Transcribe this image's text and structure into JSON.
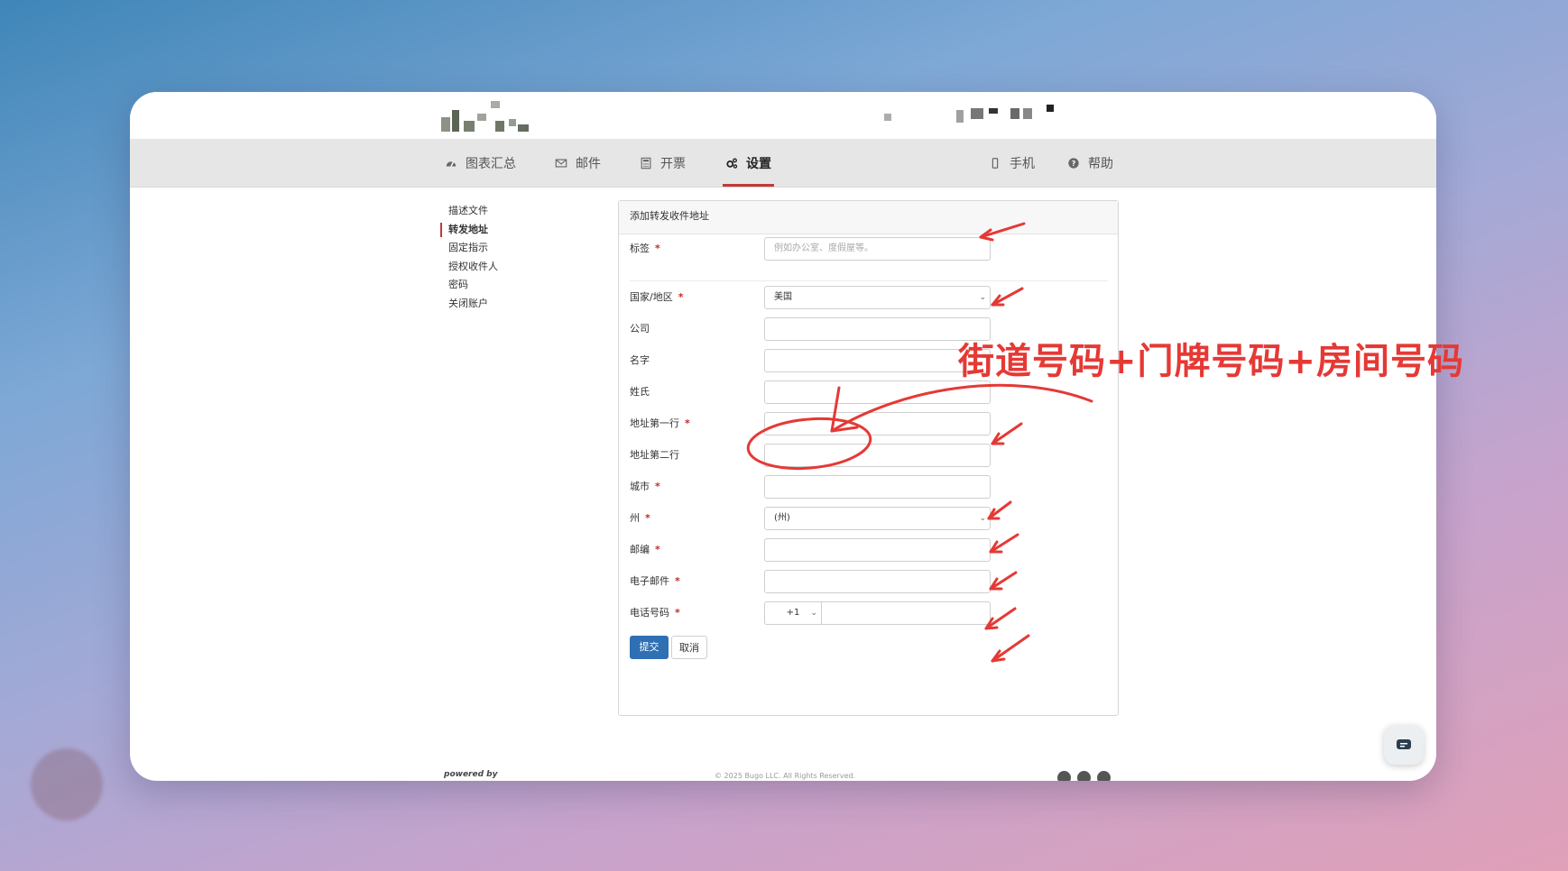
{
  "nav": {
    "left": [
      {
        "label": "图表汇总",
        "icon": "dashboard-icon"
      },
      {
        "label": "邮件",
        "icon": "envelope-icon"
      },
      {
        "label": "开票",
        "icon": "calculator-icon"
      },
      {
        "label": "设置",
        "icon": "gears-icon",
        "active": true
      }
    ],
    "right": [
      {
        "label": "手机",
        "icon": "mobile-icon"
      },
      {
        "label": "帮助",
        "icon": "question-circle-icon"
      }
    ]
  },
  "sidebar": {
    "items": [
      "描述文件",
      "转发地址",
      "固定指示",
      "授权收件人",
      "密码",
      "关闭账户"
    ],
    "active_index": 1
  },
  "form": {
    "title": "添加转发收件地址",
    "fields": [
      {
        "label": "标签",
        "required": true,
        "placeholder": "例如办公室、度假屋等。",
        "type": "text"
      },
      {
        "label": "国家/地区",
        "required": true,
        "value": "美国",
        "type": "select"
      },
      {
        "label": "公司",
        "required": false,
        "type": "text"
      },
      {
        "label": "名字",
        "required": false,
        "type": "text"
      },
      {
        "label": "姓氏",
        "required": false,
        "type": "text"
      },
      {
        "label": "地址第一行",
        "required": true,
        "type": "text"
      },
      {
        "label": "地址第二行",
        "required": false,
        "type": "text"
      },
      {
        "label": "城市",
        "required": true,
        "type": "text"
      },
      {
        "label": "州",
        "required": true,
        "value": "(州)",
        "type": "select"
      },
      {
        "label": "邮编",
        "required": true,
        "type": "text"
      },
      {
        "label": "电子邮件",
        "required": true,
        "type": "text"
      },
      {
        "label": "电话号码",
        "required": true,
        "type": "phone",
        "country_code": "+1"
      }
    ],
    "required_mark": "*",
    "submit_label": "提交",
    "cancel_label": "取消"
  },
  "annotation": {
    "text": "街道号码+门牌号码+房间号码",
    "color": "#e53935"
  },
  "footer": {
    "powered": "powered by",
    "copyright": "© 2025 Bugo LLC. All Rights Reserved."
  },
  "colors": {
    "accent": "#c4393a",
    "primary_button": "#2f6fb3",
    "navbar_bg": "#e6e6e6"
  }
}
